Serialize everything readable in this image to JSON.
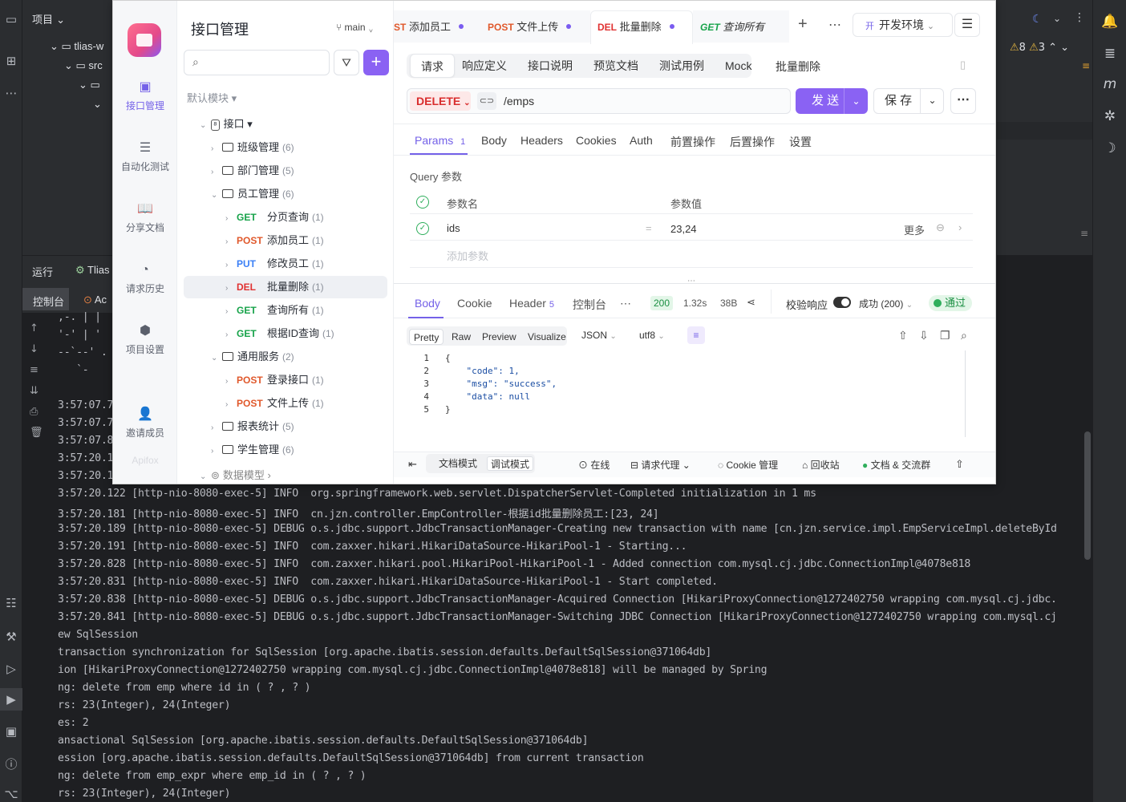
{
  "ide": {
    "project_label": "项目",
    "tree": [
      "tlias-w",
      "src"
    ],
    "run_tabs": [
      "运行",
      "Tlias"
    ],
    "console_tabs": [
      "控制台",
      "Ac"
    ],
    "warnings": "8",
    "warnings2": "3",
    "ascii_art": [
      ",-. | |",
      "'-' | '",
      "--`--' .",
      "   `-"
    ],
    "log_lines": [
      "3:57:07.7",
      "3:57:07.7",
      "3:57:07.8",
      "3:57:20.1",
      "3:57:20.1",
      "3:57:20.122 [http-nio-8080-exec-5] INFO  org.springframework.web.servlet.DispatcherServlet-Completed initialization in 1 ms",
      "3:57:20.181 [http-nio-8080-exec-5] INFO  cn.jzn.controller.EmpController-根据id批量删除员工:[23, 24]",
      "3:57:20.189 [http-nio-8080-exec-5] DEBUG o.s.jdbc.support.JdbcTransactionManager-Creating new transaction with name [cn.jzn.service.impl.EmpServiceImpl.deleteById",
      "3:57:20.191 [http-nio-8080-exec-5] INFO  com.zaxxer.hikari.HikariDataSource-HikariPool-1 - Starting...",
      "3:57:20.828 [http-nio-8080-exec-5] INFO  com.zaxxer.hikari.pool.HikariPool-HikariPool-1 - Added connection com.mysql.cj.jdbc.ConnectionImpl@4078e818",
      "3:57:20.831 [http-nio-8080-exec-5] INFO  com.zaxxer.hikari.HikariDataSource-HikariPool-1 - Start completed.",
      "3:57:20.838 [http-nio-8080-exec-5] DEBUG o.s.jdbc.support.JdbcTransactionManager-Acquired Connection [HikariProxyConnection@1272402750 wrapping com.mysql.cj.jdbc.",
      "3:57:20.841 [http-nio-8080-exec-5] DEBUG o.s.jdbc.support.JdbcTransactionManager-Switching JDBC Connection [HikariProxyConnection@1272402750 wrapping com.mysql.cj",
      "ew SqlSession",
      "transaction synchronization for SqlSession [org.apache.ibatis.session.defaults.DefaultSqlSession@371064db]",
      "ion [HikariProxyConnection@1272402750 wrapping com.mysql.cj.jdbc.ConnectionImpl@4078e818] will be managed by Spring",
      "ng: delete from emp where id in ( ? , ? )",
      "rs: 23(Integer), 24(Integer)",
      "es: 2",
      "ansactional SqlSession [org.apache.ibatis.session.defaults.DefaultSqlSession@371064db]",
      "ession [org.apache.ibatis.session.defaults.DefaultSqlSession@371064db] from current transaction",
      "ng: delete from emp_expr where emp_id in ( ? , ? )",
      "rs: 23(Integer), 24(Integer)"
    ]
  },
  "apifox": {
    "nav": [
      "接口管理",
      "自动化测试",
      "分享文档",
      "请求历史",
      "项目设置",
      "邀请成员"
    ],
    "brand": "Apifox",
    "side_title": "接口管理",
    "branch": "main",
    "module": "默认模块",
    "tree": {
      "root": "接口",
      "folders": {
        "f1": {
          "name": "班级管理",
          "count": "(6)"
        },
        "f2": {
          "name": "部门管理",
          "count": "(5)"
        },
        "f3": {
          "name": "员工管理",
          "count": "(6)"
        },
        "f4": {
          "name": "通用服务",
          "count": "(2)"
        },
        "f5": {
          "name": "报表统计",
          "count": "(5)"
        },
        "f6": {
          "name": "学生管理",
          "count": "(6)"
        },
        "f7": {
          "name": "数据模型",
          "count": ""
        }
      },
      "apis": [
        {
          "method": "GET",
          "name": "分页查询",
          "count": "(1)"
        },
        {
          "method": "POST",
          "name": "添加员工",
          "count": "(1)"
        },
        {
          "method": "PUT",
          "name": "修改员工",
          "count": "(1)"
        },
        {
          "method": "DEL",
          "name": "批量删除",
          "count": "(1)"
        },
        {
          "method": "GET",
          "name": "查询所有",
          "count": "(1)"
        },
        {
          "method": "GET",
          "name": "根据ID查询",
          "count": "(1)"
        },
        {
          "method": "POST",
          "name": "登录接口",
          "count": "(1)"
        },
        {
          "method": "POST",
          "name": "文件上传",
          "count": "(1)"
        }
      ]
    },
    "tabs": [
      {
        "method": "ST",
        "name": "添加员工"
      },
      {
        "method": "POST",
        "name": "文件上传"
      },
      {
        "method": "DEL",
        "name": "批量删除"
      },
      {
        "method": "GET",
        "name": "查询所有"
      }
    ],
    "env_badge": "开",
    "env": "开发环境",
    "subtabs": [
      "请求",
      "响应定义",
      "接口说明",
      "预览文档",
      "测试用例",
      "Mock"
    ],
    "api_name": "批量删除",
    "method": "DELETE",
    "url": "/emps",
    "send": "发 送",
    "save": "保 存",
    "param_tabs": [
      "Params",
      "Body",
      "Headers",
      "Cookies",
      "Auth",
      "前置操作",
      "后置操作",
      "设置"
    ],
    "params_count": "1",
    "query_title": "Query 参数",
    "col_name": "参数名",
    "col_value": "参数值",
    "param_name": "ids",
    "param_value": "23,24",
    "param_more": "更多",
    "add_param": "添加参数",
    "resp_tabs": [
      "Body",
      "Cookie",
      "Header",
      "控制台"
    ],
    "header_count": "5",
    "status": "200",
    "time": "1.32s",
    "size": "38B",
    "validate": "校验响应",
    "result": "成功 (200)",
    "pass": "通过",
    "view_modes": [
      "Pretty",
      "Raw",
      "Preview",
      "Visualize"
    ],
    "format": "JSON",
    "encoding": "utf8",
    "code": [
      {
        "n": "1",
        "t": "{"
      },
      {
        "n": "2",
        "t": "    \"code\": 1,"
      },
      {
        "n": "3",
        "t": "    \"msg\": \"success\","
      },
      {
        "n": "4",
        "t": "    \"data\": null"
      },
      {
        "n": "5",
        "t": "}"
      }
    ],
    "footer": {
      "doc_mode": "文档模式",
      "debug_mode": "调试模式",
      "online": "在线",
      "proxy": "请求代理",
      "cookie": "Cookie 管理",
      "recycle": "回收站",
      "community": "文档 & 交流群"
    }
  }
}
